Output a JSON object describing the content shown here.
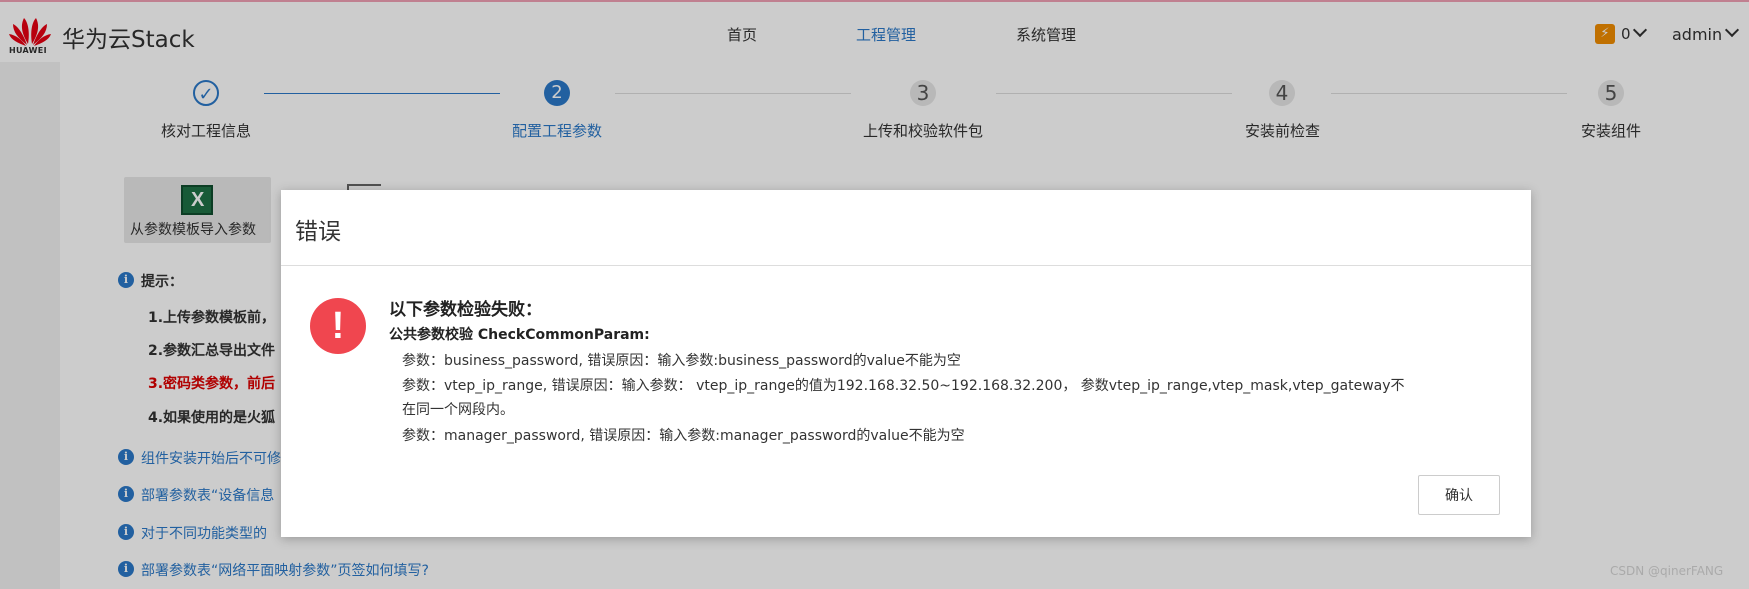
{
  "header": {
    "logo_text": "HUAWEI",
    "brand": "华为云Stack",
    "nav": [
      "首页",
      "工程管理",
      "系统管理"
    ],
    "active_nav_index": 1,
    "notif_count": "0",
    "user": "admin"
  },
  "steps": [
    {
      "num": "",
      "label": "核对工程信息",
      "state": "done"
    },
    {
      "num": "2",
      "label": "配置工程参数",
      "state": "current"
    },
    {
      "num": "3",
      "label": "上传和校验软件包",
      "state": "todo"
    },
    {
      "num": "4",
      "label": "安装前检查",
      "state": "todo"
    },
    {
      "num": "5",
      "label": "安装组件",
      "state": "todo"
    }
  ],
  "toolbar": {
    "import_label": "从参数模板导入参数"
  },
  "tips": {
    "title": "提示：",
    "items": [
      "1.上传参数模板前，",
      "2.参数汇总导出文件",
      "3.密码类参数，前后",
      "4.如果使用的是火狐"
    ]
  },
  "links": [
    "组件安装开始后不可修",
    "部署参数表“设备信息",
    "对于不同功能类型的",
    "部署参数表“网络平面映射参数”页签如何填写?"
  ],
  "dialog": {
    "title": "错误",
    "heading": "以下参数检验失败：",
    "subheading": "公共参数校验 CheckCommonParam:",
    "lines": [
      "参数：business_password, 错误原因：输入参数:business_password的value不能为空",
      "参数：vtep_ip_range, 错误原因：输入参数： vtep_ip_range的值为192.168.32.50~192.168.32.200， 参数vtep_ip_range,vtep_mask,vtep_gateway不",
      "在同一个网段内。",
      "参数：manager_password, 错误原因：输入参数:manager_password的value不能为空"
    ],
    "ok_label": "确认"
  },
  "watermark": "CSDN @qinerFANG",
  "colors": {
    "accent": "#2b79c8",
    "error": "#f0464f",
    "warning_red": "#dd0000",
    "badge": "#f08c00"
  }
}
